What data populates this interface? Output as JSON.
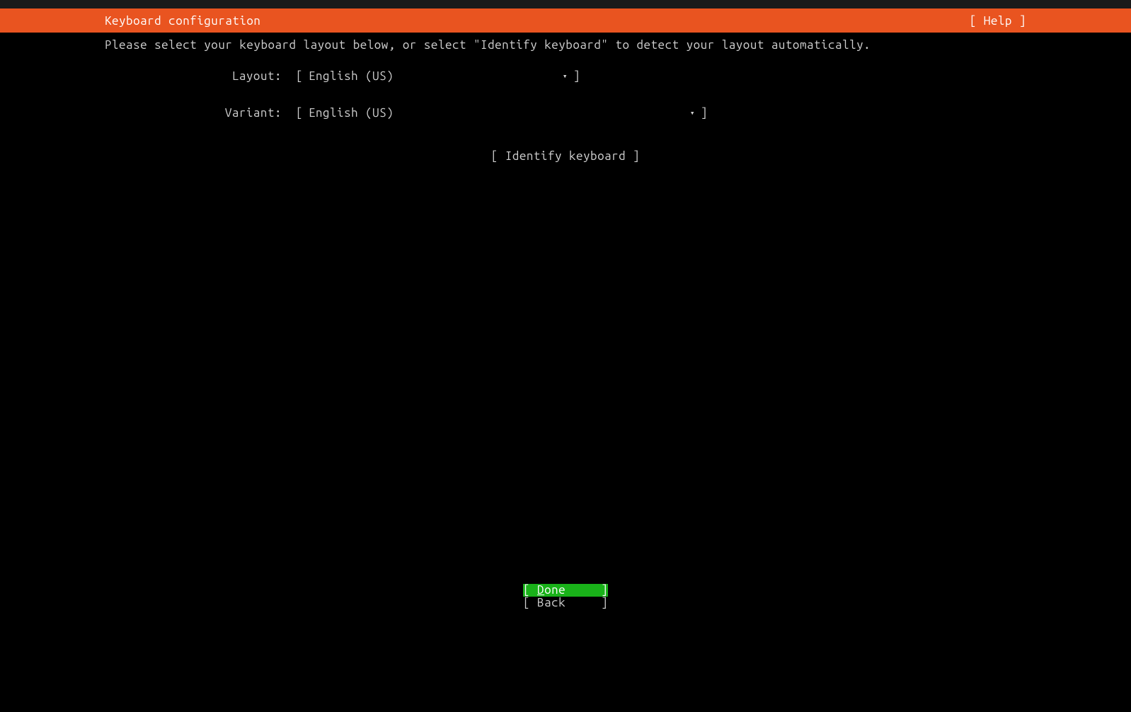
{
  "header": {
    "title": "Keyboard configuration",
    "help_label": "[ Help ]"
  },
  "instruction": "Please select your keyboard layout below, or select \"Identify keyboard\" to detect your layout automatically.",
  "layout": {
    "label": "Layout:",
    "value": "English (US)",
    "arrow": "▾"
  },
  "variant": {
    "label": "Variant:",
    "value": "English (US)",
    "arrow": "▾"
  },
  "identify": {
    "label": "[ Identify keyboard ]"
  },
  "footer": {
    "done_label": "Done",
    "back_label": "Back"
  }
}
